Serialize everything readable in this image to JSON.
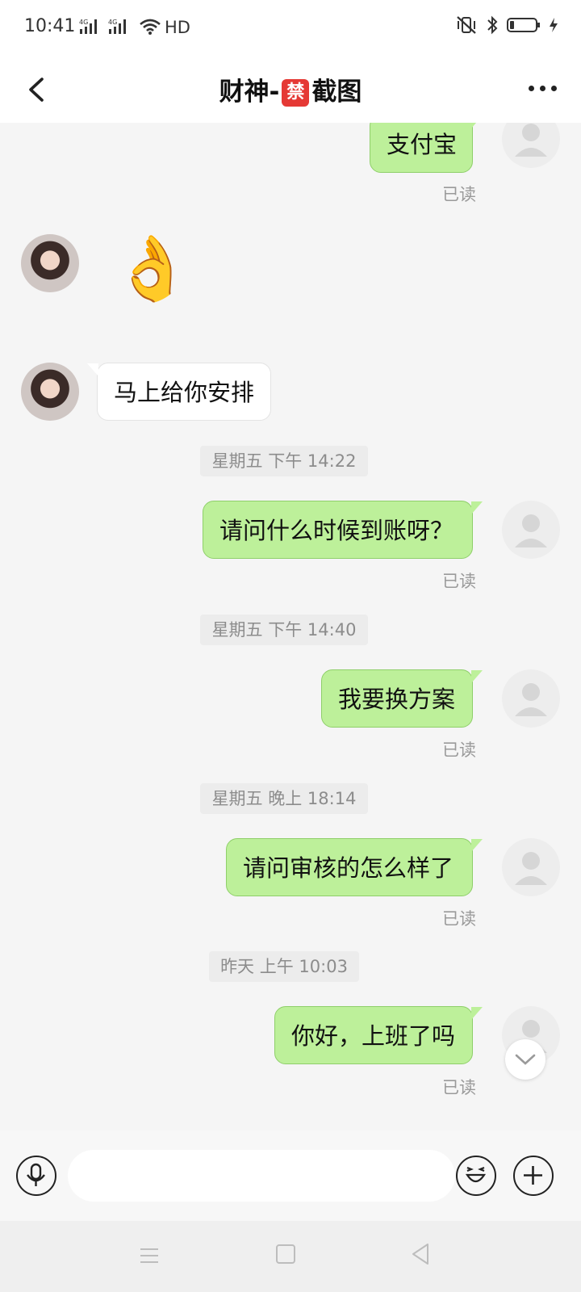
{
  "status_bar": {
    "time": "10:41",
    "net1": "4G",
    "net2": "4G",
    "hd": "HD"
  },
  "header": {
    "title_left": "财神-",
    "title_badge": "禁",
    "title_right": "截图"
  },
  "messages": [
    {
      "text": "支付宝",
      "read": "已读"
    },
    {
      "emoji": "👌"
    },
    {
      "text": "马上给你安排"
    },
    {
      "timestamp": "星期五 下午 14:22"
    },
    {
      "text": "请问什么时候到账呀？",
      "read": "已读"
    },
    {
      "timestamp": "星期五 下午 14:40"
    },
    {
      "text": "我要换方案",
      "read": "已读"
    },
    {
      "timestamp": "星期五 晚上 18:14"
    },
    {
      "text": "请问审核的怎么样了",
      "read": "已读"
    },
    {
      "timestamp": "昨天 上午 10:03"
    },
    {
      "text": "你好，上班了吗",
      "read": "已读"
    }
  ],
  "input": {
    "value": "",
    "placeholder": ""
  },
  "colors": {
    "my_bubble": "#bdf09a",
    "their_bubble": "#ffffff",
    "background": "#f5f5f5"
  }
}
